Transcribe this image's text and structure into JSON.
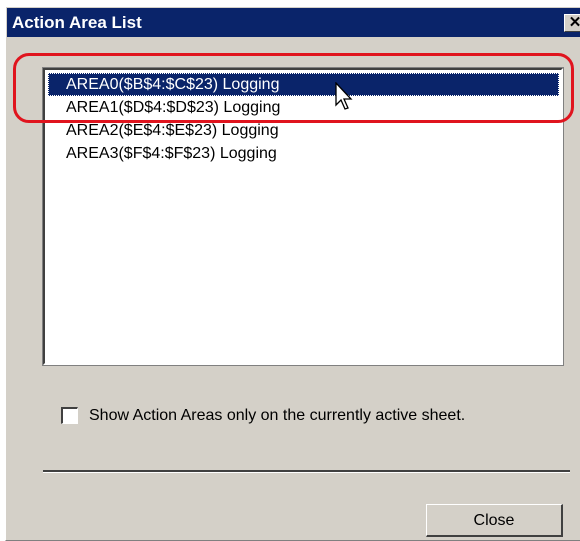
{
  "window": {
    "title": "Action Area List",
    "close_glyph": "✕"
  },
  "list": {
    "items": [
      {
        "label": "AREA0($B$4:$C$23) Logging",
        "selected": true
      },
      {
        "label": "AREA1($D$4:$D$23) Logging",
        "selected": false
      },
      {
        "label": "AREA2($E$4:$E$23) Logging",
        "selected": false
      },
      {
        "label": "AREA3($F$4:$F$23) Logging",
        "selected": false
      }
    ]
  },
  "options": {
    "show_active_sheet_only_label": "Show Action Areas only on the currently active sheet.",
    "show_active_sheet_only_checked": false
  },
  "buttons": {
    "close_label": "Close"
  },
  "colors": {
    "titlebar": "#0a246a",
    "selection": "#0a246a",
    "annotation": "#e0141e",
    "dialog_face": "#d4d0c8"
  },
  "icons": {
    "cursor": "mouse-pointer-icon",
    "window_close": "close-icon"
  }
}
